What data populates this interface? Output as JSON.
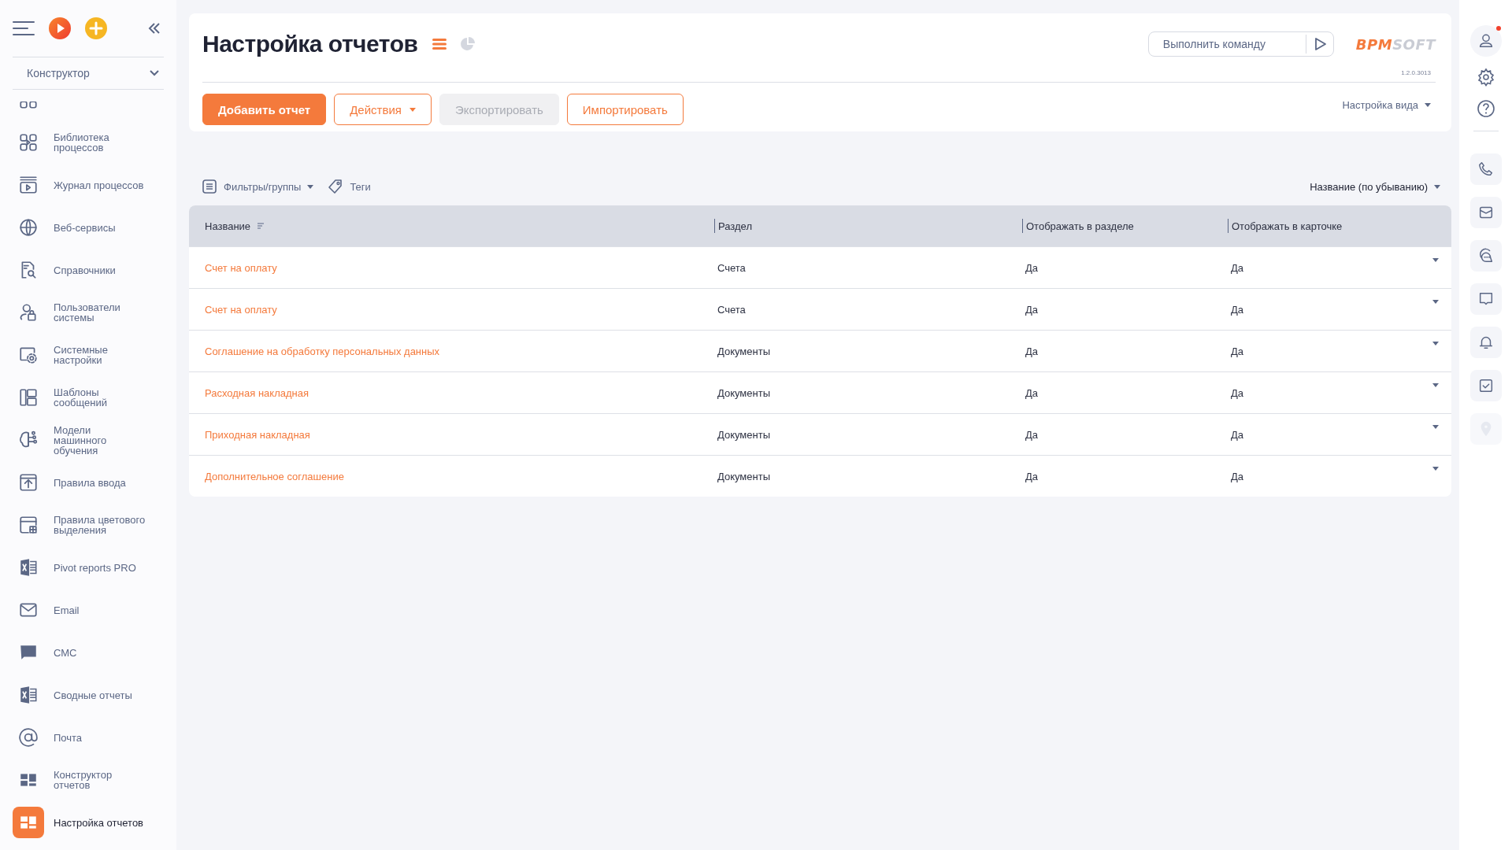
{
  "sidebar": {
    "section": "Конструктор",
    "items": [
      {
        "label": "Библиотека\nпроцессов",
        "selected": false
      },
      {
        "label": "Журнал процессов",
        "selected": false
      },
      {
        "label": "Веб-сервисы",
        "selected": false
      },
      {
        "label": "Справочники",
        "selected": false
      },
      {
        "label": "Пользователи\nсистемы",
        "selected": false
      },
      {
        "label": "Системные\nнастройки",
        "selected": false
      },
      {
        "label": "Шаблоны\nсообщений",
        "selected": false
      },
      {
        "label": "Модели\nмашинного\nобучения",
        "selected": false
      },
      {
        "label": "Правила ввода",
        "selected": false
      },
      {
        "label": "Правила цветового\nвыделения",
        "selected": false
      },
      {
        "label": "Pivot reports PRO",
        "selected": false
      },
      {
        "label": "Email",
        "selected": false
      },
      {
        "label": "СМС",
        "selected": false
      },
      {
        "label": "Сводные отчеты",
        "selected": false
      },
      {
        "label": "Почта",
        "selected": false
      },
      {
        "label": "Конструктор\nотчетов",
        "selected": false
      },
      {
        "label": "Настройка отчетов",
        "selected": true
      }
    ]
  },
  "header": {
    "title": "Настройка отчетов",
    "views": [
      {
        "kind": "list",
        "selected": true
      },
      {
        "kind": "chart",
        "selected": false
      }
    ],
    "command": {
      "placeholder": "Выполнить команду"
    },
    "logo": {
      "accent": "BPM",
      "rest": "SOFT"
    },
    "version": "1.2.0.3013",
    "buttons": [
      {
        "label": "Добавить отчет",
        "kind": "primary"
      },
      {
        "label": "Действия",
        "kind": "dropdown"
      },
      {
        "label": "Экспортировать",
        "kind": "disabled"
      },
      {
        "label": "Импортировать",
        "kind": "outline"
      }
    ],
    "view_settings": "Настройка вида"
  },
  "filters": {
    "filter_groups": "Фильтры/группы",
    "tags": "Теги",
    "sort": "Название (по убыванию)"
  },
  "table": {
    "columns": [
      "Название",
      "Раздел",
      "Отображать в разделе",
      "Отображать в карточке"
    ],
    "rows": [
      [
        "Счет на оплату",
        "Счета",
        "Да",
        "Да"
      ],
      [
        "Счет на оплату",
        "Счета",
        "Да",
        "Да"
      ],
      [
        "Соглашение на обработку персональных данных",
        "Документы",
        "Да",
        "Да"
      ],
      [
        "Расходная накладная",
        "Документы",
        "Да",
        "Да"
      ],
      [
        "Приходная накладная",
        "Документы",
        "Да",
        "Да"
      ],
      [
        "Дополнительное соглашение",
        "Документы",
        "Да",
        "Да"
      ]
    ]
  },
  "rail": {
    "profile": {
      "notification": true
    },
    "buttons": [
      {
        "kind": "phone",
        "disabled": false
      },
      {
        "kind": "mail",
        "disabled": false
      },
      {
        "kind": "chat",
        "disabled": false
      },
      {
        "kind": "message",
        "disabled": false
      },
      {
        "kind": "bell",
        "disabled": false
      },
      {
        "kind": "task",
        "disabled": false
      },
      {
        "kind": "pin",
        "disabled": true
      }
    ]
  }
}
